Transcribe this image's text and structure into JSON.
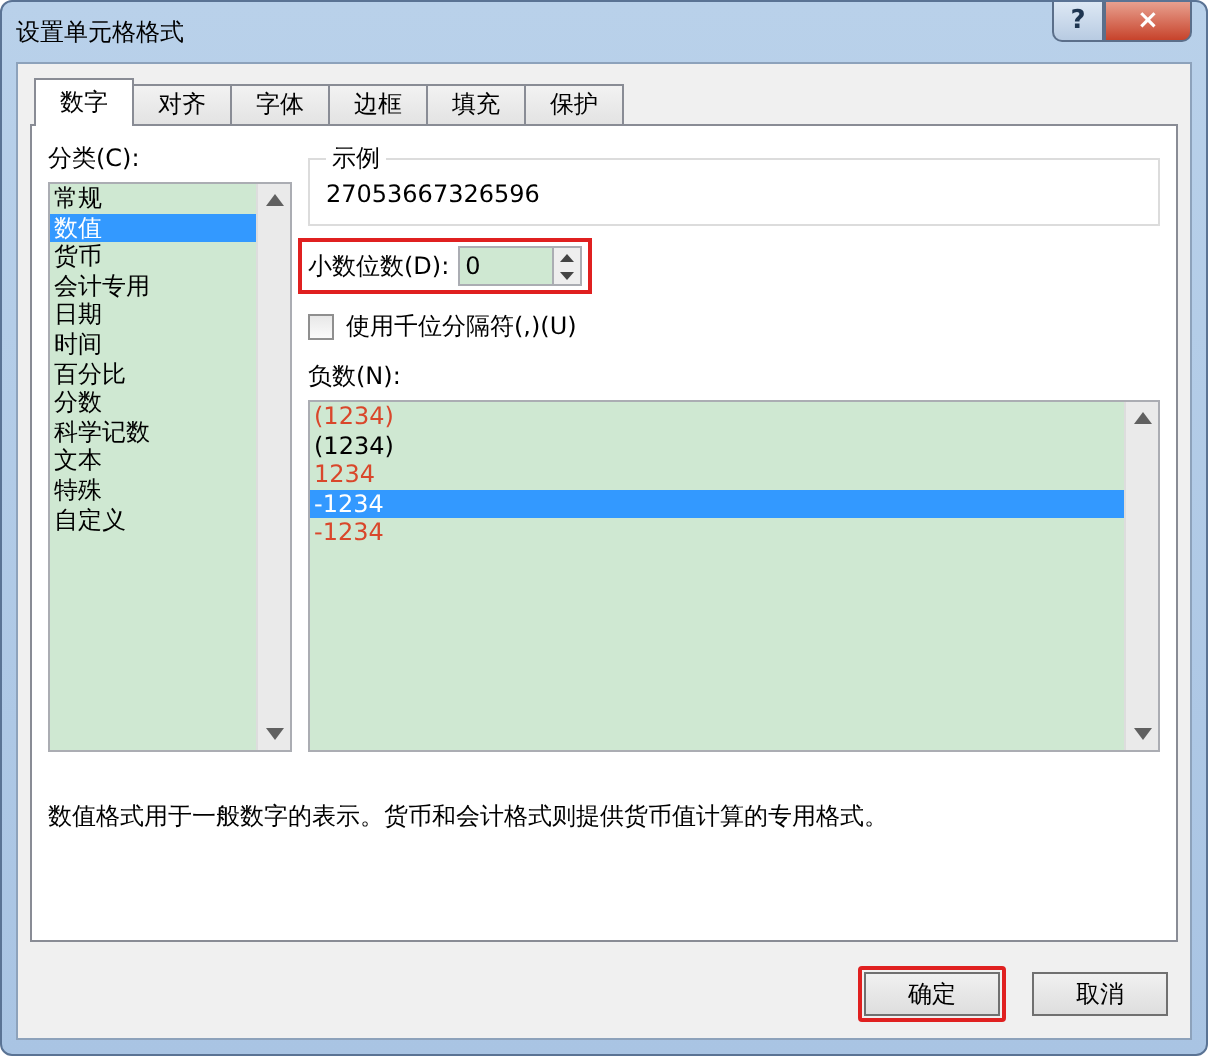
{
  "window": {
    "title": "设置单元格格式",
    "help": "?",
    "close": "×"
  },
  "tabs": [
    {
      "label": "数字",
      "selected": true
    },
    {
      "label": "对齐",
      "selected": false
    },
    {
      "label": "字体",
      "selected": false
    },
    {
      "label": "边框",
      "selected": false
    },
    {
      "label": "填充",
      "selected": false
    },
    {
      "label": "保护",
      "selected": false
    }
  ],
  "category": {
    "label": "分类(C):",
    "items": [
      {
        "label": "常规",
        "selected": false
      },
      {
        "label": "数值",
        "selected": true
      },
      {
        "label": "货币",
        "selected": false
      },
      {
        "label": "会计专用",
        "selected": false
      },
      {
        "label": "日期",
        "selected": false
      },
      {
        "label": "时间",
        "selected": false
      },
      {
        "label": "百分比",
        "selected": false
      },
      {
        "label": "分数",
        "selected": false
      },
      {
        "label": "科学记数",
        "selected": false
      },
      {
        "label": "文本",
        "selected": false
      },
      {
        "label": "特殊",
        "selected": false
      },
      {
        "label": "自定义",
        "selected": false
      }
    ]
  },
  "sample": {
    "label": "示例",
    "value": "27053667326596"
  },
  "decimal_places": {
    "label": "小数位数(D):",
    "value": "0",
    "highlighted": true
  },
  "thousands_separator": {
    "label": "使用千位分隔符(,)(U)",
    "checked": false
  },
  "negative_numbers": {
    "label": "负数(N):",
    "items": [
      {
        "label": "(1234)",
        "red": true,
        "selected": false
      },
      {
        "label": "(1234)",
        "red": false,
        "selected": false
      },
      {
        "label": "1234",
        "red": true,
        "selected": false
      },
      {
        "label": "-1234",
        "red": false,
        "selected": true
      },
      {
        "label": "-1234",
        "red": true,
        "selected": false
      }
    ]
  },
  "description": "数值格式用于一般数字的表示。货币和会计格式则提供货币值计算的专用格式。",
  "buttons": [
    {
      "label": "确定",
      "highlighted": true
    },
    {
      "label": "取消",
      "highlighted": false
    }
  ]
}
